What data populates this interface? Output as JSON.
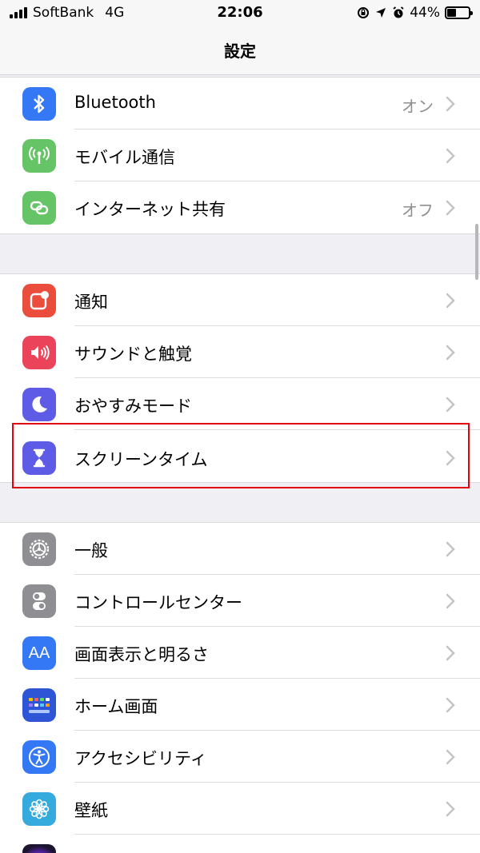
{
  "status_bar": {
    "carrier": "SoftBank",
    "network": "4G",
    "time": "22:06",
    "battery_percent": "44%",
    "battery_level": 0.44,
    "icons": [
      "rotation-lock-icon",
      "location-icon",
      "alarm-icon"
    ]
  },
  "nav": {
    "title": "設定"
  },
  "groups": [
    {
      "items": [
        {
          "label": "Bluetooth",
          "value": "オン",
          "icon": "bluetooth-icon",
          "color": "#3478f6"
        },
        {
          "label": "モバイル通信",
          "value": "",
          "icon": "antenna-icon",
          "color": "#65c466"
        },
        {
          "label": "インターネット共有",
          "value": "オフ",
          "icon": "hotspot-icon",
          "color": "#65c466"
        }
      ]
    },
    {
      "items": [
        {
          "label": "通知",
          "value": "",
          "icon": "notifications-icon",
          "color": "#eb4d3d"
        },
        {
          "label": "サウンドと触覚",
          "value": "",
          "icon": "speaker-icon",
          "color": "#eb445a"
        },
        {
          "label": "おやすみモード",
          "value": "",
          "icon": "moon-icon",
          "color": "#5e5ce6"
        },
        {
          "label": "スクリーンタイム",
          "value": "",
          "icon": "hourglass-icon",
          "color": "#5e5ce6"
        }
      ]
    },
    {
      "items": [
        {
          "label": "一般",
          "value": "",
          "icon": "gear-icon",
          "color": "#8e8e93"
        },
        {
          "label": "コントロールセンター",
          "value": "",
          "icon": "toggles-icon",
          "color": "#8e8e93"
        },
        {
          "label": "画面表示と明るさ",
          "value": "",
          "icon": "text-size-icon",
          "color": "#3478f6",
          "icon_text": "AA"
        },
        {
          "label": "ホーム画面",
          "value": "",
          "icon": "home-grid-icon",
          "color": "#2d55d5"
        },
        {
          "label": "アクセシビリティ",
          "value": "",
          "icon": "accessibility-icon",
          "color": "#3478f6"
        },
        {
          "label": "壁紙",
          "value": "",
          "icon": "wallpaper-flower-icon",
          "color": "#35aadc"
        },
        {
          "label": "",
          "value": "",
          "icon": "siri-icon",
          "color": "#2b1f3a"
        }
      ]
    }
  ]
}
